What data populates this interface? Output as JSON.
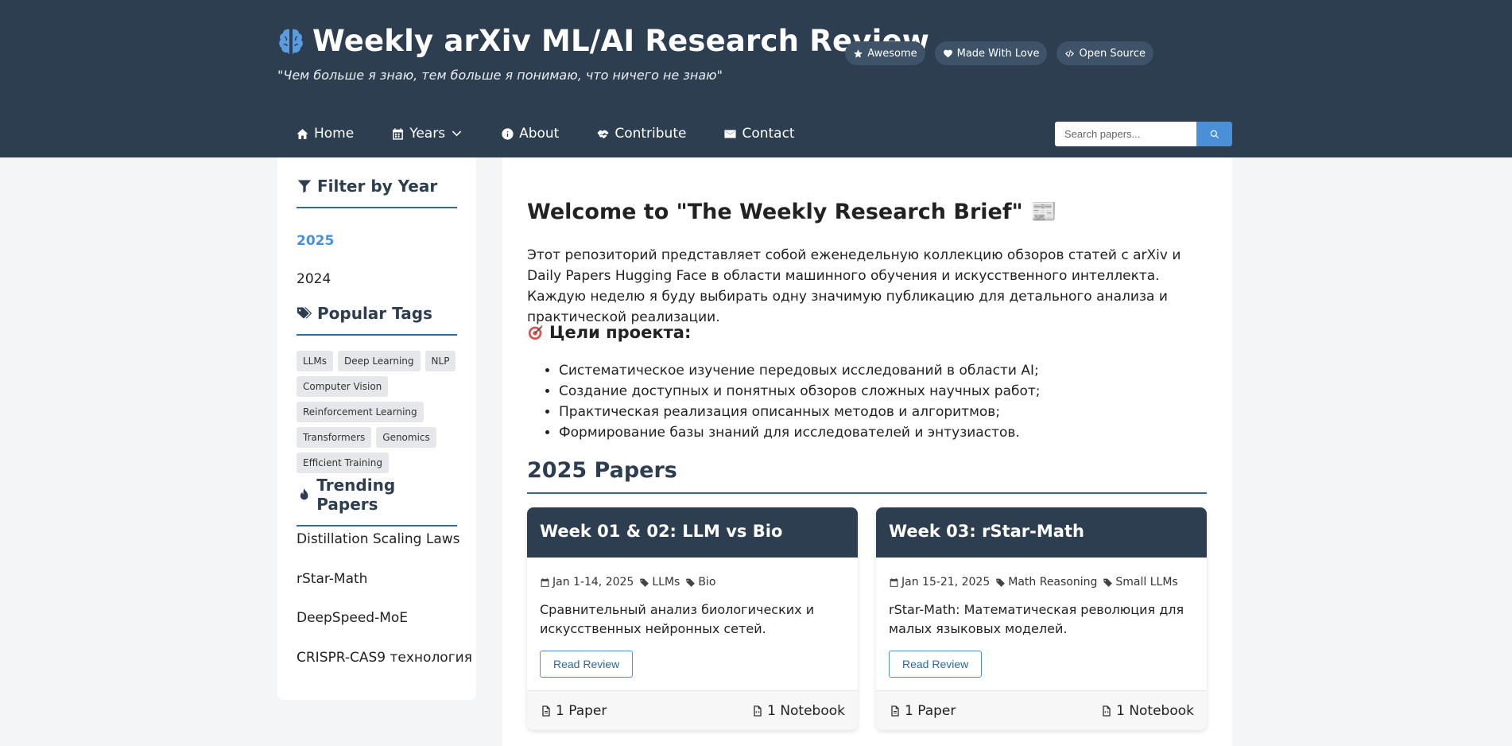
{
  "header": {
    "title": "Weekly arXiv ML/AI Research Review",
    "tagline": "\"Чем больше я знаю, тем больше я понимаю, что ничего не знаю\"",
    "logo_icon": "brain-icon",
    "background_color": "#2c3e50",
    "badges": [
      {
        "label": "Awesome",
        "icon": "star-icon"
      },
      {
        "label": "Made With Love",
        "icon": "heart-icon"
      },
      {
        "label": "Open Source",
        "icon": "code-icon"
      }
    ]
  },
  "nav": {
    "items": [
      {
        "label": "Home",
        "icon": "home-icon"
      },
      {
        "label": "Years",
        "icon": "calendar-icon"
      },
      {
        "label": "About",
        "icon": "info-icon"
      },
      {
        "label": "Contribute",
        "icon": "handshake-icon"
      },
      {
        "label": "Contact",
        "icon": "envelope-icon"
      }
    ],
    "search_placeholder": "Search papers...",
    "search_value": ""
  },
  "sidebar": {
    "filter_heading": "Filter by Year",
    "years": [
      "2025",
      "2024"
    ],
    "active_year": "2025",
    "tags_heading": "Popular Tags",
    "tags": [
      "LLMs",
      "Deep Learning",
      "NLP",
      "Computer Vision",
      "Reinforcement Learning",
      "Transformers",
      "Genomics",
      "Efficient Training"
    ],
    "trending_heading": "Trending Papers",
    "trending": [
      "Distillation Scaling Laws",
      "rStar-Math",
      "DeepSpeed-MoE",
      "CRISPR-CAS9 технология"
    ]
  },
  "main": {
    "welcome": "Welcome to \"The Weekly Research Brief\" 📰",
    "intro": "Этот репозиторий представляет собой еженедельную коллекцию обзоров статей с arXiv и Daily Papers Hugging Face в области машинного обучения и искусственного интеллекта. Каждую неделю я буду выбирать одну значимую публикацию для детального анализа и практической реализации.",
    "goals_title": "Цели проекта:",
    "goals": [
      "Систематическое изучение передовых исследований в области AI;",
      "Создание доступных и понятных обзоров сложных научных работ;",
      "Практическая реализация описанных методов и алгоритмов;",
      "Формирование базы знаний для исследователей и энтузиастов."
    ],
    "year_title": "2025 Papers",
    "accent_color": "#4a90d9",
    "cards": [
      {
        "title": "Week 01 & 02: LLM vs Bio",
        "date": "Jan 1-14, 2025",
        "tags": [
          "LLMs",
          "Bio"
        ],
        "desc": "Сравнительный анализ биологических и искусственных нейронных сетей.",
        "button": "Read Review",
        "papers": "1 Paper",
        "notebooks": "1 Notebook"
      },
      {
        "title": "Week 03: rStar-Math",
        "date": "Jan 15-21, 2025",
        "tags": [
          "Math Reasoning",
          "Small LLMs"
        ],
        "desc": "rStar-Math: Математическая революция для малых языковых моделей.",
        "button": "Read Review",
        "papers": "1 Paper",
        "notebooks": "1 Notebook"
      }
    ]
  }
}
